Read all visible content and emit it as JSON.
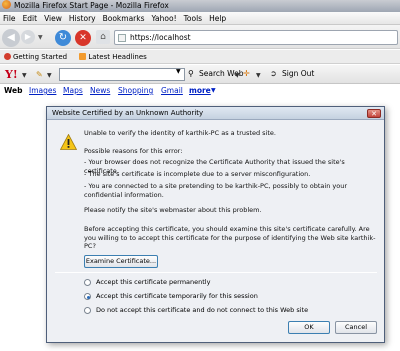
{
  "window": {
    "title": "Mozilla Firefox Start Page - Mozilla Firefox"
  },
  "menu": [
    "File",
    "Edit",
    "View",
    "History",
    "Bookmarks",
    "Yahoo!",
    "Tools",
    "Help"
  ],
  "nav": {
    "url": "https://localhost"
  },
  "bookmarks": [
    "Getting Started",
    "Latest Headlines"
  ],
  "yahoo_toolbar": {
    "logo": "Y!",
    "search_label": "Search Web",
    "signout_label": "Sign Out"
  },
  "search_links": {
    "active": "Web",
    "items": [
      "Images",
      "Maps",
      "News",
      "Shopping",
      "Gmail"
    ],
    "more": "more"
  },
  "dialog": {
    "title": "Website Certified by an Unknown Authority",
    "intro": "Unable to verify the identity of karthik-PC as a trusted site.",
    "reasons_heading": "Possible reasons for this error:",
    "reasons": [
      "- Your browser does not recognize the Certificate Authority that issued the site's certificate.",
      "- The site's certificate is incomplete due to a server misconfiguration.",
      "- You are connected to a site pretending to be karthik-PC, possibly to obtain your confidential information."
    ],
    "notify": "Please notify the site's webmaster about this problem.",
    "examine_prompt": "Before accepting this certificate, you should examine this site's certificate carefully. Are you willing to to accept this certificate for the purpose of identifying the Web site karthik-PC?",
    "examine_button": "Examine Certificate...",
    "options": [
      {
        "label": "Accept this certificate permanently",
        "selected": false
      },
      {
        "label": "Accept this certificate temporarily for this session",
        "selected": true
      },
      {
        "label": "Do not accept this certificate and do not connect to this Web site",
        "selected": false
      }
    ],
    "ok": "OK",
    "cancel": "Cancel"
  }
}
